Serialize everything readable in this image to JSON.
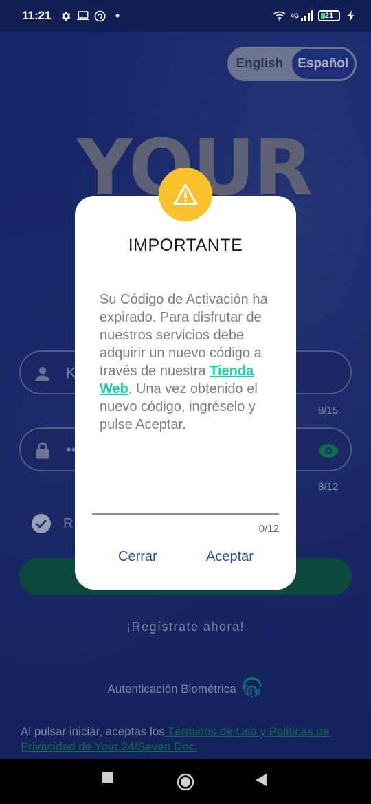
{
  "status_bar": {
    "time": "11:21",
    "network": "4G",
    "battery": "21"
  },
  "language_toggle": {
    "english": "English",
    "spanish": "Español",
    "selected": "Español"
  },
  "logo": {
    "text": "YOUR"
  },
  "login_form": {
    "username": {
      "value": "K",
      "counter": "8/15"
    },
    "password": {
      "value": "••",
      "counter": "8/12"
    },
    "remember_label": "R"
  },
  "register_link": "¡Regístrate ahora!",
  "biometric_label": "Autenticación Biométrica",
  "terms": {
    "prefix": "Al pulsar iniciar, aceptas los",
    "link": " Términos de Uso y Políticas de Privacidad de Your 24/Seven Doc."
  },
  "dialog": {
    "title": "IMPORTANTE",
    "message_before": "Su Código de Activación ha expirado. Para disfrutar de nuestros servicios debe adquirir un nuevo código a través de nuestra ",
    "store_link": "Tienda Web",
    "message_after": ". Una vez obtenido el nuevo código, ingréselo y pulse Aceptar.",
    "input_value": "",
    "input_counter": "0/12",
    "close_label": "Cerrar",
    "accept_label": "Aceptar"
  },
  "colors": {
    "background": "#1c2f7a",
    "accent_green": "#17d4a0",
    "warning_yellow": "#f9c22c",
    "dialog_button": "#2b4bb0"
  },
  "icons": {
    "user": "user-icon",
    "lock": "lock-icon",
    "eye": "eye-icon",
    "fingerprint": "fingerprint-icon",
    "warning": "warning-icon"
  }
}
